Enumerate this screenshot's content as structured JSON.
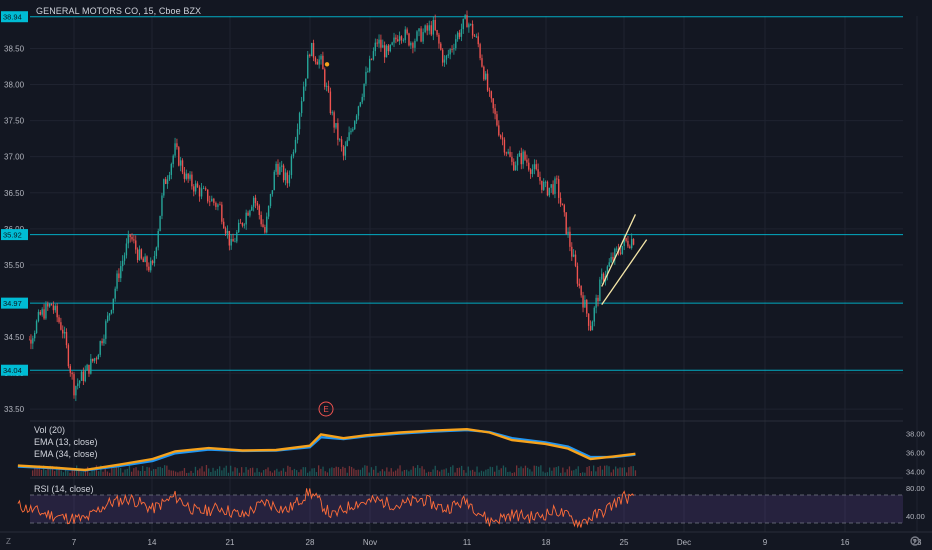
{
  "header": {
    "title": "GENERAL MOTORS CO, 15, Cboe BZX"
  },
  "price_axis": {
    "ticks": [
      "38.50",
      "38.00",
      "37.50",
      "37.00",
      "36.50",
      "36.00",
      "35.50",
      "35.00",
      "34.50",
      "34.00",
      "33.50"
    ]
  },
  "levels": [
    {
      "value": 38.94,
      "label": "38.94"
    },
    {
      "value": 35.92,
      "label": "35.92"
    },
    {
      "value": 34.97,
      "label": "34.97"
    },
    {
      "value": 34.04,
      "label": "34.04"
    }
  ],
  "volume_axis": {
    "ticks": [
      "38.00",
      "36.00",
      "34.00"
    ]
  },
  "rsi_axis": {
    "ticks": [
      "80.00",
      "40.00"
    ]
  },
  "x_axis": {
    "ticks": [
      "7",
      "14",
      "21",
      "28",
      "Nov",
      "11",
      "18",
      "25",
      "Dec",
      "9",
      "16",
      "23"
    ]
  },
  "legend": {
    "vol": "Vol (20)",
    "ema13": "EMA (13, close)",
    "ema34": "EMA (34, close)",
    "rsi": "RSI (14, close)"
  },
  "earnings_marker": "E",
  "corner_left": "Z",
  "colors": {
    "background": "#131722",
    "up": "#26a69a",
    "down": "#ef5350",
    "level": "#00bcd4",
    "ema13": "#f7a21b",
    "ema34": "#2196f3",
    "rsi": "#ff6d3a",
    "channel": "#f5e6a8"
  },
  "chart_data": {
    "type": "candlestick",
    "symbol": "GENERAL MOTORS CO",
    "interval": "15",
    "exchange": "Cboe BZX",
    "ylim": [
      33.35,
      38.95
    ],
    "price_path": [
      {
        "x": "Oct 2",
        "y": 34.95
      },
      {
        "x": "Oct 3",
        "y": 34.45
      },
      {
        "x": "Oct 4",
        "y": 34.8
      },
      {
        "x": "Oct 5",
        "y": 34.95
      },
      {
        "x": "Oct 6",
        "y": 34.6
      },
      {
        "x": "Oct 7",
        "y": 33.8
      },
      {
        "x": "Oct 8",
        "y": 34.0
      },
      {
        "x": "Oct 9",
        "y": 34.25
      },
      {
        "x": "Oct 10",
        "y": 34.75
      },
      {
        "x": "Oct 11",
        "y": 35.4
      },
      {
        "x": "Oct 12",
        "y": 35.9
      },
      {
        "x": "Oct 13",
        "y": 35.55
      },
      {
        "x": "Oct 14",
        "y": 35.45
      },
      {
        "x": "Oct 15",
        "y": 36.6
      },
      {
        "x": "Oct 16",
        "y": 37.1
      },
      {
        "x": "Oct 17",
        "y": 36.7
      },
      {
        "x": "Oct 18",
        "y": 36.55
      },
      {
        "x": "Oct 20",
        "y": 36.3
      },
      {
        "x": "Oct 21",
        "y": 35.75
      },
      {
        "x": "Oct 22",
        "y": 36.1
      },
      {
        "x": "Oct 23",
        "y": 36.45
      },
      {
        "x": "Oct 24",
        "y": 35.95
      },
      {
        "x": "Oct 25",
        "y": 36.9
      },
      {
        "x": "Oct 26",
        "y": 36.65
      },
      {
        "x": "Oct 28",
        "y": 38.5
      },
      {
        "x": "Oct 29",
        "y": 38.3
      },
      {
        "x": "Oct 30",
        "y": 37.55
      },
      {
        "x": "Oct 31",
        "y": 37.0
      },
      {
        "x": "Nov 1",
        "y": 37.55
      },
      {
        "x": "Nov 2",
        "y": 38.1
      },
      {
        "x": "Nov 3",
        "y": 38.6
      },
      {
        "x": "Nov 4",
        "y": 38.4
      },
      {
        "x": "Nov 5",
        "y": 38.75
      },
      {
        "x": "Nov 6",
        "y": 38.6
      },
      {
        "x": "Nov 8",
        "y": 38.8
      },
      {
        "x": "Nov 9",
        "y": 38.3
      },
      {
        "x": "Nov 10",
        "y": 38.65
      },
      {
        "x": "Nov 11",
        "y": 38.9
      },
      {
        "x": "Nov 12",
        "y": 38.55
      },
      {
        "x": "Nov 13",
        "y": 37.8
      },
      {
        "x": "Nov 14",
        "y": 37.3
      },
      {
        "x": "Nov 15",
        "y": 36.9
      },
      {
        "x": "Nov 16",
        "y": 37.0
      },
      {
        "x": "Nov 17",
        "y": 36.8
      },
      {
        "x": "Nov 18",
        "y": 36.55
      },
      {
        "x": "Nov 19",
        "y": 36.6
      },
      {
        "x": "Nov 20",
        "y": 35.9
      },
      {
        "x": "Nov 21",
        "y": 35.2
      },
      {
        "x": "Nov 22",
        "y": 34.65
      },
      {
        "x": "Nov 23",
        "y": 35.3
      },
      {
        "x": "Nov 24",
        "y": 35.6
      },
      {
        "x": "Nov 25",
        "y": 35.8
      },
      {
        "x": "Nov 26",
        "y": 35.88
      }
    ],
    "horizontal_levels": [
      38.94,
      35.92,
      34.97,
      34.04
    ],
    "channel": {
      "upper": [
        {
          "x": "Nov 23",
          "y": 35.2
        },
        {
          "x": "Nov 26",
          "y": 36.2
        }
      ],
      "lower": [
        {
          "x": "Nov 23",
          "y": 34.95
        },
        {
          "x": "Nov 27",
          "y": 35.85
        }
      ]
    },
    "earnings_date": "Oct 29",
    "panes": {
      "ema": {
        "ylim": [
          33.5,
          39.0
        ],
        "ema13": [
          {
            "x": "Oct 2",
            "y": 34.6
          },
          {
            "x": "Oct 5",
            "y": 34.4
          },
          {
            "x": "Oct 8",
            "y": 34.15
          },
          {
            "x": "Oct 11",
            "y": 34.7
          },
          {
            "x": "Oct 14",
            "y": 35.3
          },
          {
            "x": "Oct 16",
            "y": 36.1
          },
          {
            "x": "Oct 19",
            "y": 36.45
          },
          {
            "x": "Oct 22",
            "y": 36.2
          },
          {
            "x": "Oct 25",
            "y": 36.25
          },
          {
            "x": "Oct 28",
            "y": 36.7
          },
          {
            "x": "Oct 29",
            "y": 37.9
          },
          {
            "x": "Oct 31",
            "y": 37.5
          },
          {
            "x": "Nov 2",
            "y": 37.8
          },
          {
            "x": "Nov 5",
            "y": 38.1
          },
          {
            "x": "Nov 8",
            "y": 38.3
          },
          {
            "x": "Nov 11",
            "y": 38.45
          },
          {
            "x": "Nov 13",
            "y": 38.1
          },
          {
            "x": "Nov 15",
            "y": 37.3
          },
          {
            "x": "Nov 18",
            "y": 36.9
          },
          {
            "x": "Nov 20",
            "y": 36.4
          },
          {
            "x": "Nov 22",
            "y": 35.3
          },
          {
            "x": "Nov 24",
            "y": 35.55
          },
          {
            "x": "Nov 26",
            "y": 35.85
          }
        ],
        "ema34": [
          {
            "x": "Oct 2",
            "y": 34.5
          },
          {
            "x": "Oct 5",
            "y": 34.35
          },
          {
            "x": "Oct 8",
            "y": 34.1
          },
          {
            "x": "Oct 11",
            "y": 34.55
          },
          {
            "x": "Oct 14",
            "y": 35.1
          },
          {
            "x": "Oct 16",
            "y": 35.9
          },
          {
            "x": "Oct 19",
            "y": 36.3
          },
          {
            "x": "Oct 22",
            "y": 36.15
          },
          {
            "x": "Oct 25",
            "y": 36.2
          },
          {
            "x": "Oct 28",
            "y": 36.55
          },
          {
            "x": "Oct 29",
            "y": 37.6
          },
          {
            "x": "Oct 31",
            "y": 37.4
          },
          {
            "x": "Nov 2",
            "y": 37.7
          },
          {
            "x": "Nov 5",
            "y": 38.0
          },
          {
            "x": "Nov 8",
            "y": 38.2
          },
          {
            "x": "Nov 11",
            "y": 38.35
          },
          {
            "x": "Nov 13",
            "y": 38.15
          },
          {
            "x": "Nov 15",
            "y": 37.5
          },
          {
            "x": "Nov 18",
            "y": 37.05
          },
          {
            "x": "Nov 20",
            "y": 36.6
          },
          {
            "x": "Nov 22",
            "y": 35.5
          },
          {
            "x": "Nov 24",
            "y": 35.5
          },
          {
            "x": "Nov 26",
            "y": 35.75
          }
        ]
      },
      "rsi": {
        "ylim": [
          20,
          90
        ],
        "bands": [
          70,
          30
        ],
        "values": [
          {
            "x": "Oct 2",
            "y": 55
          },
          {
            "x": "Oct 4",
            "y": 45
          },
          {
            "x": "Oct 6",
            "y": 38
          },
          {
            "x": "Oct 8",
            "y": 35
          },
          {
            "x": "Oct 10",
            "y": 58
          },
          {
            "x": "Oct 12",
            "y": 65
          },
          {
            "x": "Oct 14",
            "y": 50
          },
          {
            "x": "Oct 16",
            "y": 68
          },
          {
            "x": "Oct 18",
            "y": 45
          },
          {
            "x": "Oct 20",
            "y": 52
          },
          {
            "x": "Oct 22",
            "y": 40
          },
          {
            "x": "Oct 24",
            "y": 60
          },
          {
            "x": "Oct 26",
            "y": 48
          },
          {
            "x": "Oct 28",
            "y": 75
          },
          {
            "x": "Oct 30",
            "y": 40
          },
          {
            "x": "Nov 1",
            "y": 58
          },
          {
            "x": "Nov 3",
            "y": 62
          },
          {
            "x": "Nov 5",
            "y": 55
          },
          {
            "x": "Nov 7",
            "y": 64
          },
          {
            "x": "Nov 9",
            "y": 50
          },
          {
            "x": "Nov 11",
            "y": 62
          },
          {
            "x": "Nov 13",
            "y": 32
          },
          {
            "x": "Nov 15",
            "y": 42
          },
          {
            "x": "Nov 17",
            "y": 38
          },
          {
            "x": "Nov 19",
            "y": 48
          },
          {
            "x": "Nov 21",
            "y": 30
          },
          {
            "x": "Nov 23",
            "y": 45
          },
          {
            "x": "Nov 25",
            "y": 68
          },
          {
            "x": "Nov 26",
            "y": 62
          }
        ]
      }
    }
  }
}
